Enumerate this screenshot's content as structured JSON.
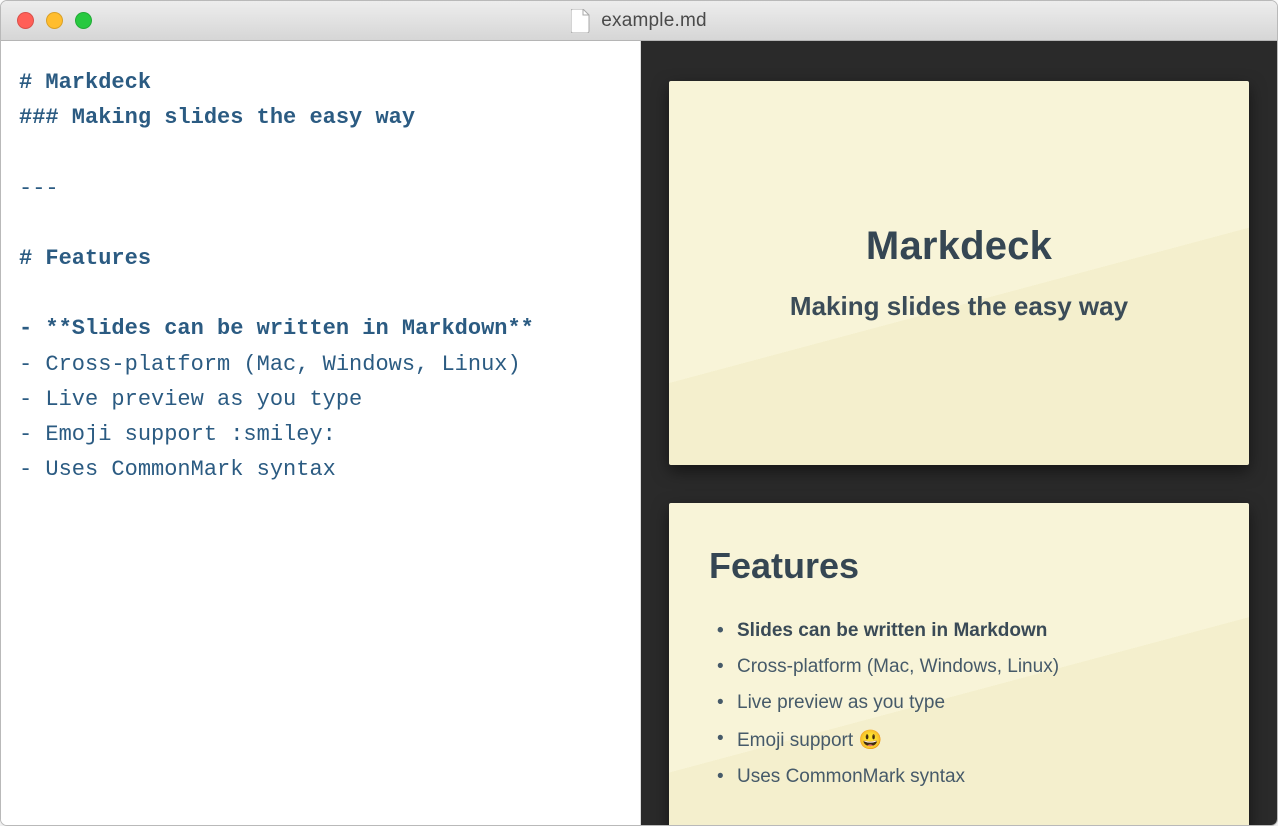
{
  "window": {
    "title": "example.md"
  },
  "editor": {
    "lines": [
      {
        "text": "# Markdeck",
        "cls": "h"
      },
      {
        "text": "### Making slides the easy way",
        "cls": "h"
      },
      {
        "text": "",
        "cls": ""
      },
      {
        "text": "---",
        "cls": ""
      },
      {
        "text": "",
        "cls": ""
      },
      {
        "text": "# Features",
        "cls": "h"
      },
      {
        "text": "",
        "cls": ""
      },
      {
        "text": "- **Slides can be written in Markdown**",
        "cls": "bold"
      },
      {
        "text": "- Cross-platform (Mac, Windows, Linux)",
        "cls": ""
      },
      {
        "text": "- Live preview as you type",
        "cls": ""
      },
      {
        "text": "- Emoji support :smiley:",
        "cls": ""
      },
      {
        "text": "- Uses CommonMark syntax",
        "cls": ""
      }
    ]
  },
  "preview": {
    "slide1": {
      "title": "Markdeck",
      "subtitle": "Making slides the easy way"
    },
    "slide2": {
      "title": "Features",
      "items": [
        {
          "text": "Slides can be written in Markdown",
          "bold": true
        },
        {
          "text": "Cross-platform (Mac, Windows, Linux)",
          "bold": false
        },
        {
          "text": "Live preview as you type",
          "bold": false
        },
        {
          "text": "Emoji support 😃",
          "bold": false
        },
        {
          "text": "Uses CommonMark syntax",
          "bold": false
        }
      ]
    }
  }
}
